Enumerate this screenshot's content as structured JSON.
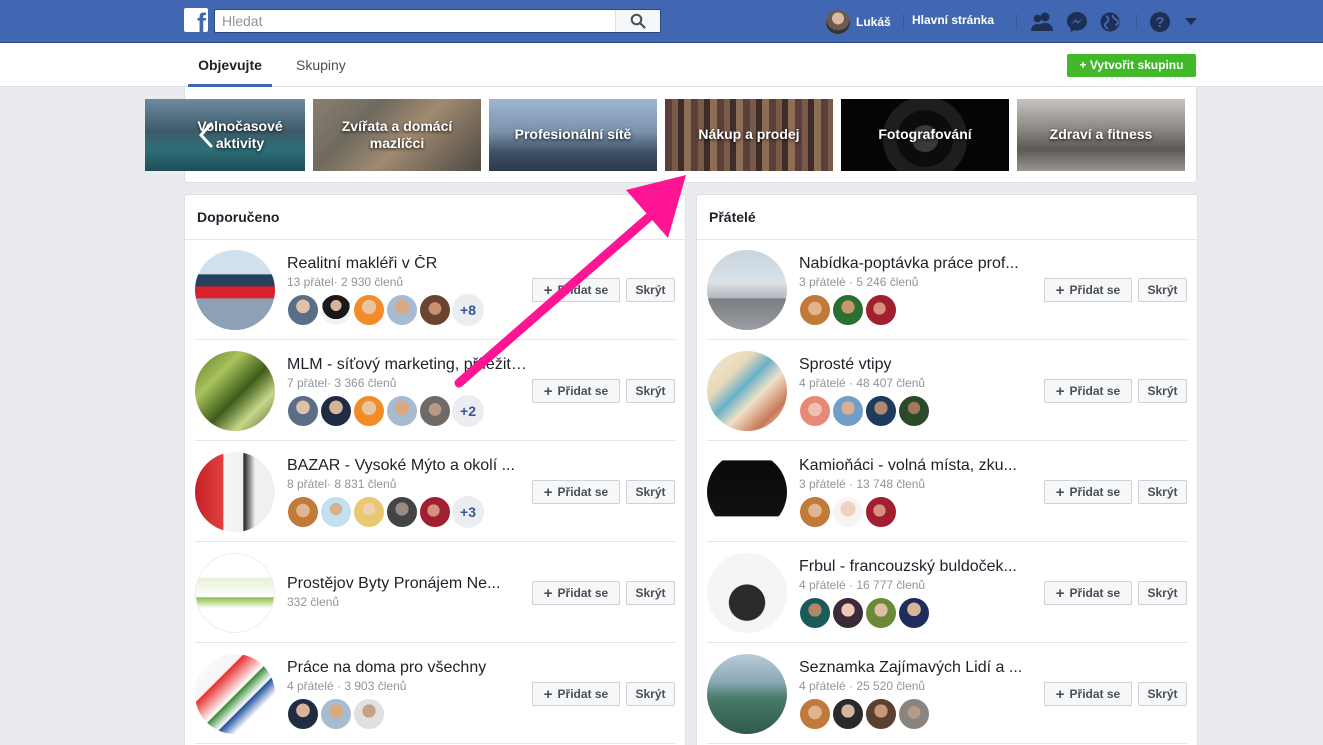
{
  "header": {
    "logo": "f",
    "search_placeholder": "Hledat",
    "user_name": "Lukáš",
    "home_label": "Hlavní stránka",
    "icons": [
      "search-icon",
      "friends-icon",
      "messenger-icon",
      "globe-icon",
      "help-icon",
      "caret-down-icon"
    ],
    "brand_color": "#4267b2"
  },
  "subnav": {
    "tabs": [
      "Objevujte",
      "Skupiny"
    ],
    "create_label": "+ Vytvořit skupinu"
  },
  "categories": [
    "Volnočasové aktivity",
    "Zvířata a domácí mazlíčci",
    "Profesionální sítě",
    "Nákup a prodej",
    "Fotografování",
    "Zdraví a fitness"
  ],
  "recommended": {
    "title": "Doporučeno",
    "join_label": "Přidat se",
    "hide_label": "Skrýt",
    "groups": [
      {
        "name": "Realitní makléři v ČR",
        "meta": "13 přátel· 2 930 členů",
        "more": "+8"
      },
      {
        "name": "MLM - síťový marketing, příležitosti",
        "meta": "7 přátel· 3 366 členů",
        "more": "+2"
      },
      {
        "name": "BAZAR - Vysoké Mýto a okolí ...",
        "meta": "8 přátel· 8 831 členů",
        "more": "+3"
      },
      {
        "name": "Prostějov Byty Pronájem Ne...",
        "meta": "332 členů",
        "more": ""
      },
      {
        "name": "Práce na doma pro všechny",
        "meta": "4 přátelé · 3 903 členů",
        "more": ""
      }
    ]
  },
  "friends": {
    "title": "Přátelé",
    "join_label": "Přidat se",
    "hide_label": "Skrýt",
    "groups": [
      {
        "name": "Nabídka-poptávka práce prof...",
        "meta": "3 přátelé · 5 246 členů"
      },
      {
        "name": "Sprosté vtipy",
        "meta": "4 přátelé · 48 407 členů"
      },
      {
        "name": "Kamioňáci - volná místa, zku...",
        "meta": "3 přátelé · 13 748 členů"
      },
      {
        "name": "Frbul - francouzský buldoček...",
        "meta": "4 přátelé · 16 777 členů"
      },
      {
        "name": "Seznamka Zajímavých Lidí a ...",
        "meta": "4 přátelé · 25 520 členů"
      }
    ]
  },
  "annotation": {
    "color": "#ff1493"
  }
}
